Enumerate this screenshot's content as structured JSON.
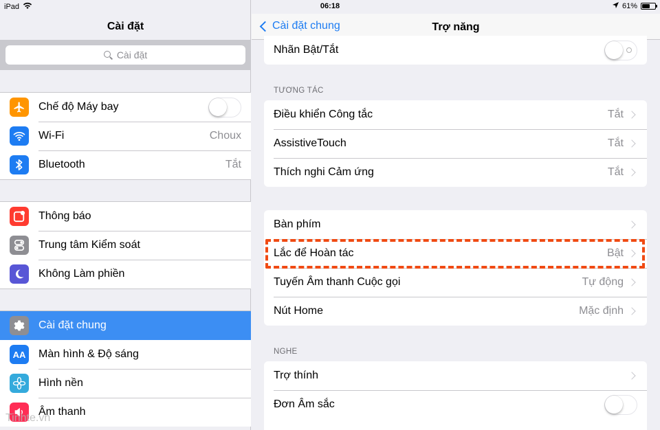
{
  "status_bar": {
    "device": "iPad",
    "time": "06:18",
    "battery": "61%",
    "battery_level": 0.61
  },
  "master": {
    "title": "Cài đặt",
    "search_placeholder": "Cài đặt",
    "groups": [
      [
        {
          "label": "Chế độ Máy bay",
          "icon": "airplane-icon",
          "icon_color": "#ff9500",
          "toggle": false
        },
        {
          "label": "Wi-Fi",
          "icon": "wifi-icon",
          "icon_color": "#1d7cf2",
          "value": "Choux"
        },
        {
          "label": "Bluetooth",
          "icon": "bluetooth-icon",
          "icon_color": "#1d7cf2",
          "value": "Tắt"
        }
      ],
      [
        {
          "label": "Thông báo",
          "icon": "notifications-icon",
          "icon_color": "#ff3b30"
        },
        {
          "label": "Trung tâm Kiểm soát",
          "icon": "control-center-icon",
          "icon_color": "#8e8e93"
        },
        {
          "label": "Không Làm phiền",
          "icon": "moon-icon",
          "icon_color": "#5856d6"
        }
      ],
      [
        {
          "label": "Cài đặt chung",
          "icon": "gear-icon",
          "icon_color": "#8e8e93",
          "selected": true
        },
        {
          "label": "Màn hình & Độ sáng",
          "icon": "display-icon",
          "icon_color": "#1d7cf2"
        },
        {
          "label": "Hình nền",
          "icon": "wallpaper-icon",
          "icon_color": "#34aadc"
        },
        {
          "label": "Âm thanh",
          "icon": "sound-icon",
          "icon_color": "#ff2d55"
        }
      ]
    ]
  },
  "detail": {
    "back_label": "Cài đặt chung",
    "title": "Trợ năng",
    "top_row": {
      "label": "Nhãn Bật/Tắt",
      "toggle": false
    },
    "section_interaction": "TƯƠNG TÁC",
    "interaction_rows": [
      {
        "label": "Điều khiển Công tắc",
        "value": "Tắt"
      },
      {
        "label": "AssistiveTouch",
        "value": "Tắt"
      },
      {
        "label": "Thích nghi Cảm ứng",
        "value": "Tắt"
      }
    ],
    "misc_rows": [
      {
        "label": "Bàn phím",
        "value": ""
      },
      {
        "label": "Lắc để Hoàn tác",
        "value": "Bật"
      },
      {
        "label": "Tuyến Âm thanh Cuộc gọi",
        "value": "Tự động"
      },
      {
        "label": "Nút Home",
        "value": "Mặc định"
      }
    ],
    "section_hearing": "NGHE",
    "hearing_rows": [
      {
        "label": "Trợ thính",
        "value": ""
      },
      {
        "label": "Đơn Âm sắc",
        "toggle": false
      }
    ]
  },
  "watermark": "Tinhte.vn",
  "colors": {
    "accent": "#1d7cf2",
    "selected_row": "#3c8ef3",
    "highlight_border": "#f04a13"
  }
}
